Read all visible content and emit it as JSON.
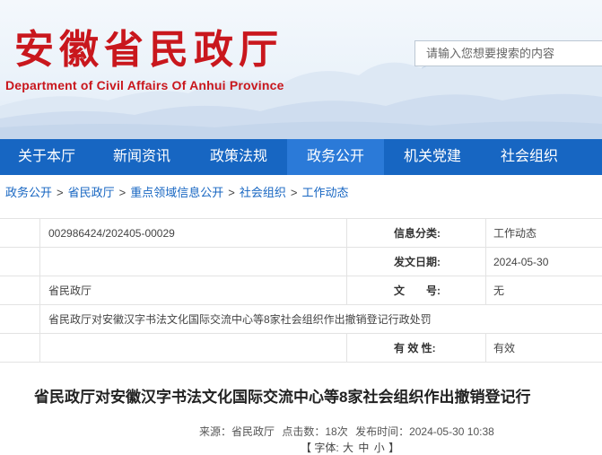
{
  "header": {
    "site_title": "安徽省民政厅",
    "site_subtitle": "Department of Civil Affairs Of Anhui Province",
    "search_placeholder": "请输入您想要搜索的内容",
    "brand_color": "#c9171d"
  },
  "nav": {
    "color": "#1766c2",
    "items": [
      {
        "label": "关于本厅"
      },
      {
        "label": "新闻资讯"
      },
      {
        "label": "政策法规"
      },
      {
        "label": "政务公开",
        "active": true
      },
      {
        "label": "机关党建"
      },
      {
        "label": "社会组织"
      }
    ]
  },
  "breadcrumb": {
    "items": [
      "政务公开",
      "省民政厅",
      "重点领域信息公开",
      "社会组织",
      "工作动态"
    ],
    "separator": ">"
  },
  "info": {
    "index_no": "002986424/202405-00029",
    "category_label": "信息分类:",
    "category": "工作动态",
    "date_label": "发文日期:",
    "date": "2024-05-30",
    "publisher": "省民政厅",
    "docno_label_1": "文",
    "docno_label_2": "号:",
    "docno": "无",
    "subject": "省民政厅对安徽汉字书法文化国际交流中心等8家社会组织作出撤销登记行政处罚",
    "validity_label": "有 效 性:",
    "validity": "有效"
  },
  "article": {
    "title": "省民政厅对安徽汉字书法文化国际交流中心等8家社会组织作出撤销登记行",
    "source": "来源：省民政厅",
    "clicks": "点击数：18次",
    "pub_time": "发布时间：2024-05-30 10:38",
    "fontsize_open": "【 字体:",
    "fontsize_big": "大",
    "fontsize_mid": "中",
    "fontsize_small": "小",
    "fontsize_close": "】"
  }
}
